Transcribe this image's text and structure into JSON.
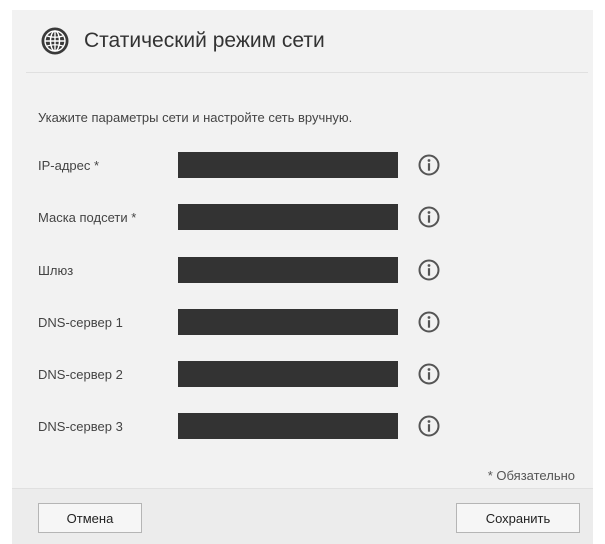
{
  "dialog": {
    "title": "Статический режим сети",
    "title_icon": "globe-icon",
    "instruction": "Укажите параметры сети и настройте сеть вручную.",
    "fields": [
      {
        "id": "ip-address",
        "label": "IP-адрес *",
        "value": "",
        "info_icon": "info-icon"
      },
      {
        "id": "subnet-mask",
        "label": "Маска подсети *",
        "value": "",
        "info_icon": "info-icon"
      },
      {
        "id": "gateway",
        "label": "Шлюз",
        "value": "",
        "info_icon": "info-icon"
      },
      {
        "id": "dns-server-1",
        "label": "DNS-сервер 1",
        "value": "",
        "info_icon": "info-icon"
      },
      {
        "id": "dns-server-2",
        "label": "DNS-сервер 2",
        "value": "",
        "info_icon": "info-icon"
      },
      {
        "id": "dns-server-3",
        "label": "DNS-сервер 3",
        "value": "",
        "info_icon": "info-icon"
      }
    ],
    "required_note": "* Обязательно"
  },
  "footer": {
    "cancel_label": "Отмена",
    "save_label": "Сохранить"
  },
  "colors": {
    "dialog_background": "#f2f2f2",
    "input_background": "#333333",
    "text": "#444444"
  }
}
